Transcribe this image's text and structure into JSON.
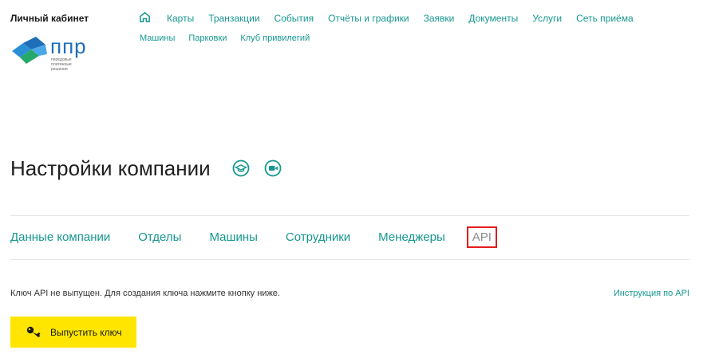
{
  "header": {
    "cabinet_label": "Личный кабинет",
    "logo_text": "ппр",
    "logo_subtext": "передовые платежные решения",
    "nav_row1": [
      "Карты",
      "Транзакции",
      "События",
      "Отчёты и графики",
      "Заявки",
      "Документы",
      "Услуги",
      "Сеть приёма"
    ],
    "nav_row2": [
      "Машины",
      "Парковки",
      "Клуб привилегий"
    ]
  },
  "page": {
    "title": "Настройки компании",
    "title_icons": [
      "graduation-cap-icon",
      "video-camera-icon"
    ]
  },
  "tabs": [
    "Данные компании",
    "Отделы",
    "Машины",
    "Сотрудники",
    "Менеджеры",
    "API"
  ],
  "active_tab": "API",
  "api": {
    "info_text": "Ключ API не выпущен. Для создания ключа нажмите кнопку ниже.",
    "instruction_link": "Инструкция по API",
    "issue_button": "Выпустить ключ"
  },
  "colors": {
    "accent": "#16978f",
    "button_bg": "#ffe500",
    "active_border": "#e41c1c",
    "logo_blue": "#1f6fb8"
  }
}
